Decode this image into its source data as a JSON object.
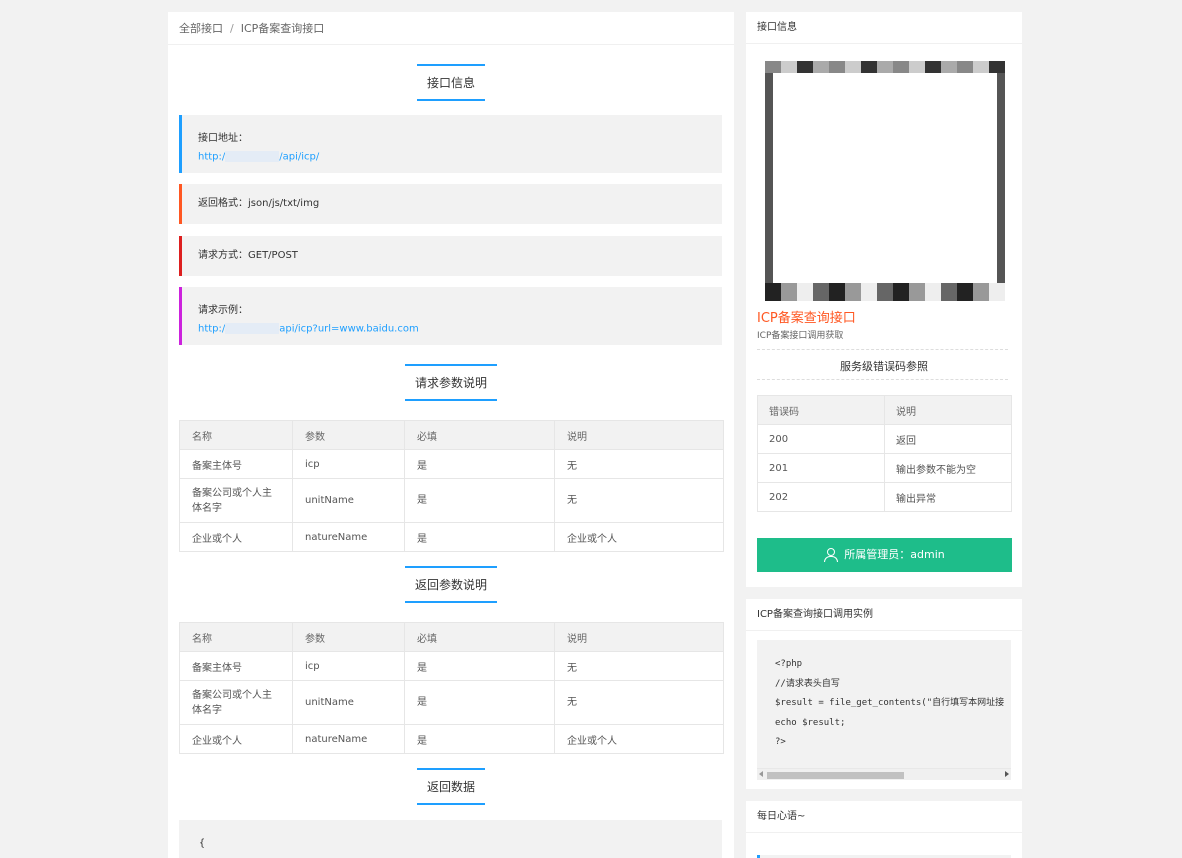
{
  "breadcrumb": {
    "root": "全部接口",
    "sep": "/",
    "current": "ICP备案查询接口"
  },
  "sections": {
    "info": "接口信息",
    "req_params": "请求参数说明",
    "resp_params": "返回参数说明",
    "resp_data": "返回数据"
  },
  "info": {
    "address_label": "接口地址：",
    "address_prefix": "http:/",
    "address_suffix": "/api/icp/",
    "format": "返回格式：json/js/txt/img",
    "method": "请求方式：GET/POST",
    "example_label": "请求示例：",
    "example_prefix": "http:/",
    "example_suffix": "api/icp?url=www.baidu.com"
  },
  "req_table": {
    "headers": [
      "名称",
      "参数",
      "必填",
      "说明"
    ],
    "rows": [
      [
        "备案主体号",
        "icp",
        "是",
        "无"
      ],
      [
        "备案公司或个人主体名字",
        "unitName",
        "是",
        "无"
      ],
      [
        "企业或个人",
        "natureName",
        "是",
        "企业或个人"
      ]
    ]
  },
  "resp_table": {
    "headers": [
      "名称",
      "参数",
      "必填",
      "说明"
    ],
    "rows": [
      [
        "备案主体号",
        "icp",
        "是",
        "无"
      ],
      [
        "备案公司或个人主体名字",
        "unitName",
        "是",
        "无"
      ],
      [
        "企业或个人",
        "natureName",
        "是",
        "企业或个人"
      ]
    ]
  },
  "resp_code": "{",
  "side": {
    "info_title": "接口信息",
    "api_name": "ICP备案查询接口",
    "api_desc": "ICP备案接口调用获取",
    "err_title": "服务级错误码参照",
    "err_headers": [
      "错误码",
      "说明"
    ],
    "err_rows": [
      [
        "200",
        "返回"
      ],
      [
        "201",
        "输出参数不能为空"
      ],
      [
        "202",
        "输出异常"
      ]
    ],
    "admin_label": "所属管理员：admin",
    "example_title": "ICP备案查询接口调用实例",
    "code": "<?php\n//请求表头自写\n$result = file_get_contents(\"自行填写本网址接\necho $result;\n?>",
    "motto_title": "每日心语~"
  },
  "colors": {
    "accent": "#1e9fff",
    "orange": "#ff5722",
    "green": "#1ebd8a"
  }
}
